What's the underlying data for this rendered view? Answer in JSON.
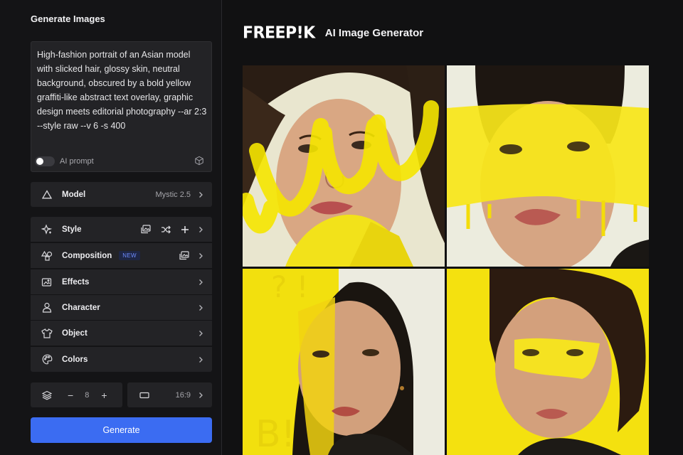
{
  "panel": {
    "title": "Generate Images"
  },
  "prompt": {
    "text": "High-fashion portrait of an Asian model with slicked hair, glossy skin, neutral background, obscured by a bold yellow graffiti-like abstract text overlay, graphic design meets editorial photography --ar 2:3 --style raw --v 6 -s 400",
    "ai_prompt_label": "AI prompt",
    "ai_prompt_enabled": false
  },
  "model": {
    "label": "Model",
    "value": "Mystic 2.5"
  },
  "options": [
    {
      "label": "Style",
      "icon": "sparkle-icon"
    },
    {
      "label": "Composition",
      "icon": "shapes-icon",
      "badge": "NEW"
    },
    {
      "label": "Effects",
      "icon": "image-effects-icon"
    },
    {
      "label": "Character",
      "icon": "person-icon"
    },
    {
      "label": "Object",
      "icon": "shirt-icon"
    },
    {
      "label": "Colors",
      "icon": "palette-icon"
    }
  ],
  "count": {
    "value": "8",
    "minus": "−",
    "plus": "+"
  },
  "aspect_ratio": {
    "value": "16:9"
  },
  "generate_label": "Generate",
  "brand": {
    "logo": "FREEP!K",
    "product": "AI Image Generator"
  },
  "colors": {
    "accent": "#3b6cf2",
    "panel": "#232326",
    "background": "#111112",
    "yellow": "#f7e10a"
  }
}
